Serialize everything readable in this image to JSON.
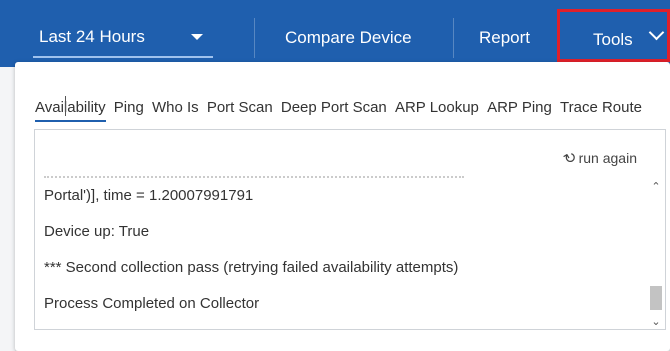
{
  "nav": {
    "time_range": "Last 24 Hours",
    "compare_device": "Compare Device",
    "report": "Report",
    "tools": "Tools"
  },
  "colors": {
    "topbar": "#1f5fae",
    "highlight": "#e0202a"
  },
  "tabs": [
    {
      "label": "Availability",
      "active": true
    },
    {
      "label": "Ping",
      "active": false
    },
    {
      "label": "Who Is",
      "active": false
    },
    {
      "label": "Port Scan",
      "active": false
    },
    {
      "label": "Deep Port Scan",
      "active": false
    },
    {
      "label": "ARP Lookup",
      "active": false
    },
    {
      "label": "ARP Ping",
      "active": false
    },
    {
      "label": "Trace Route",
      "active": false
    }
  ],
  "output": {
    "run_again": "run again",
    "run_again_icon": "refresh-icon",
    "lines": [
      "Portal')], time = 1.20007991791",
      "Device up: True",
      "*** Second collection pass (retrying failed availability attempts)",
      "Process Completed on Collector"
    ]
  }
}
